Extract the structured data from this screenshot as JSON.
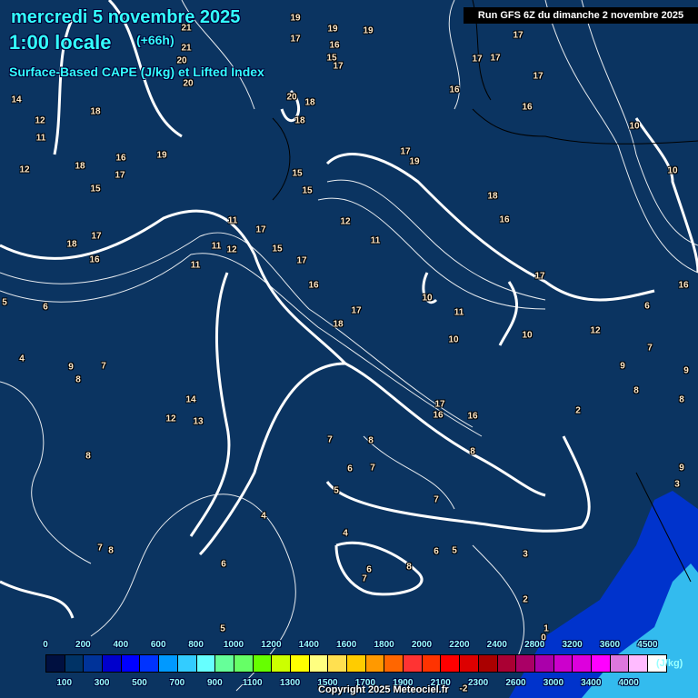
{
  "header": {
    "date": "mercredi 5 novembre 2025",
    "time": "1:00 locale",
    "lead": "(+66h)",
    "subtitle": "Surface-Based CAPE (J/kg) et Lifted Index",
    "run": "Run GFS 6Z du dimanche 2 novembre 2025"
  },
  "map_labels": [
    "19",
    "19",
    "19",
    "17",
    "16",
    "15",
    "17",
    "21",
    "21",
    "20",
    "20",
    "20",
    "18",
    "18",
    "17",
    "17",
    "17",
    "17",
    "16",
    "16",
    "15",
    "19",
    "19",
    "18",
    "18",
    "16",
    "14",
    "12",
    "11",
    "12",
    "18",
    "17",
    "16",
    "15",
    "17",
    "17",
    "11",
    "11",
    "11",
    "12",
    "11",
    "17",
    "16",
    "18",
    "17",
    "10",
    "12",
    "15",
    "17",
    "16",
    "11",
    "16",
    "17",
    "10",
    "18",
    "17",
    "15",
    "10",
    "16",
    "14",
    "13",
    "12",
    "9",
    "8",
    "7",
    "6",
    "5",
    "4",
    "8",
    "7",
    "8",
    "6",
    "5",
    "7",
    "4",
    "5",
    "6",
    "4",
    "3",
    "2",
    "1",
    "0",
    "-2",
    "12",
    "16",
    "10",
    "10",
    "8",
    "7",
    "9",
    "9",
    "8",
    "8",
    "9",
    "3",
    "2",
    "6",
    "8",
    "7",
    "6",
    "8",
    "7",
    "7",
    "5",
    "6"
  ],
  "legend": {
    "top_labels": [
      "0",
      "200",
      "400",
      "600",
      "800",
      "1000",
      "1200",
      "1400",
      "1600",
      "1800",
      "2000",
      "2200",
      "2400",
      "2800",
      "3200",
      "3600",
      "4500"
    ],
    "bottom_labels": [
      "100",
      "300",
      "500",
      "700",
      "900",
      "1100",
      "1300",
      "1500",
      "1700",
      "1900",
      "2100",
      "2300",
      "2600",
      "3000",
      "3400",
      "4000"
    ],
    "unit": "(J/kg)",
    "colors": [
      "#001040",
      "#003366",
      "#003399",
      "#0000cc",
      "#0000ff",
      "#0033ff",
      "#0099ff",
      "#33ccff",
      "#66ffff",
      "#66ff99",
      "#66ff66",
      "#66ff00",
      "#ccff00",
      "#ffff00",
      "#ffff80",
      "#ffe050",
      "#ffcc00",
      "#ff9900",
      "#ff6600",
      "#ff3333",
      "#ff3300",
      "#ff0000",
      "#dd0000",
      "#aa0000",
      "#aa0033",
      "#aa0066",
      "#aa00aa",
      "#cc00cc",
      "#dd00dd",
      "#ff00ff",
      "#dd77dd",
      "#ffbbff",
      "#ffffff"
    ]
  },
  "copyright": "Copyright 2025 Meteociel.fr"
}
